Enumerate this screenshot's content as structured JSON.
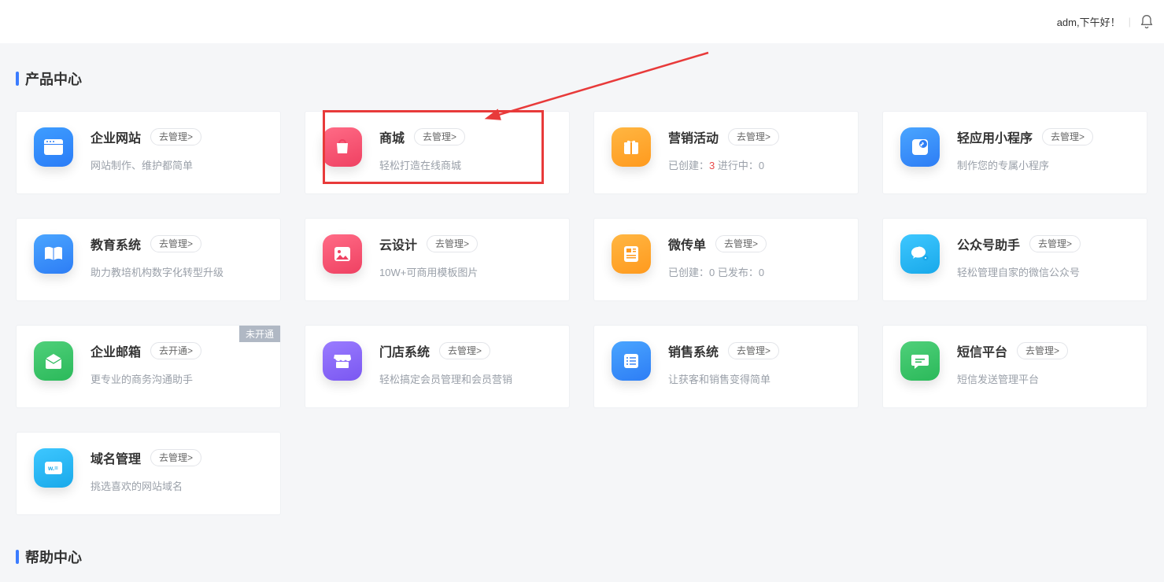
{
  "header": {
    "greeting": "adm,下午好！"
  },
  "sections": {
    "products_title": "产品中心",
    "help_title": "帮助中心"
  },
  "badges": {
    "not_open": "未开通"
  },
  "btn": {
    "manage": "去管理>",
    "open": "去开通>"
  },
  "cards": {
    "r0c0": {
      "title": "企业网站",
      "desc": "网站制作、维护都简单"
    },
    "r0c1": {
      "title": "商城",
      "desc": "轻松打造在线商城"
    },
    "r0c2": {
      "title": "营销活动",
      "desc_prefix": "已创建：",
      "count_created": "3",
      "desc_mid": "   进行中：",
      "count_running": "0"
    },
    "r0c3": {
      "title": "轻应用小程序",
      "desc": "制作您的专属小程序"
    },
    "r1c0": {
      "title": "教育系统",
      "desc": "助力教培机构数字化转型升级"
    },
    "r1c1": {
      "title": "云设计",
      "desc": "10W+可商用模板图片"
    },
    "r1c2": {
      "title": "微传单",
      "desc_prefix": "已创建：",
      "count_created": "0",
      "desc_mid": "   已发布：",
      "count_published": "0"
    },
    "r1c3": {
      "title": "公众号助手",
      "desc": "轻松管理自家的微信公众号"
    },
    "r2c0": {
      "title": "企业邮箱",
      "desc": "更专业的商务沟通助手"
    },
    "r2c1": {
      "title": "门店系统",
      "desc": "轻松搞定会员管理和会员营销"
    },
    "r2c2": {
      "title": "销售系统",
      "desc": "让获客和销售变得简单"
    },
    "r2c3": {
      "title": "短信平台",
      "desc": "短信发送管理平台"
    },
    "r3c0": {
      "title": "域名管理",
      "desc": "挑选喜欢的网站域名"
    }
  },
  "icons": {
    "r0c0": {
      "bg": "linear-gradient(160deg,#3e9dff,#2a7cf7)"
    },
    "r0c1": {
      "bg": "linear-gradient(160deg,#ff6b86,#ef4162)"
    },
    "r0c2": {
      "bg": "linear-gradient(160deg,#ffb642,#ff9a1e)"
    },
    "r0c3": {
      "bg": "linear-gradient(160deg,#4aa5ff,#2d7df5)"
    },
    "r1c0": {
      "bg": "linear-gradient(160deg,#4aa5ff,#2d7df5)"
    },
    "r1c1": {
      "bg": "linear-gradient(160deg,#ff6b86,#ef4162)"
    },
    "r1c2": {
      "bg": "linear-gradient(160deg,#ffb642,#ff9a1e)"
    },
    "r1c3": {
      "bg": "linear-gradient(160deg,#3ec7ff,#19a9ea)"
    },
    "r2c0": {
      "bg": "linear-gradient(160deg,#4fd07a,#2bb95a)"
    },
    "r2c1": {
      "bg": "linear-gradient(160deg,#9a7cff,#7a57f1)"
    },
    "r2c2": {
      "bg": "linear-gradient(160deg,#4aa5ff,#2d7df5)"
    },
    "r2c3": {
      "bg": "linear-gradient(160deg,#4fd07a,#2bb95a)"
    },
    "r3c0": {
      "bg": "linear-gradient(160deg,#3ec7ff,#19a9ea)"
    }
  }
}
